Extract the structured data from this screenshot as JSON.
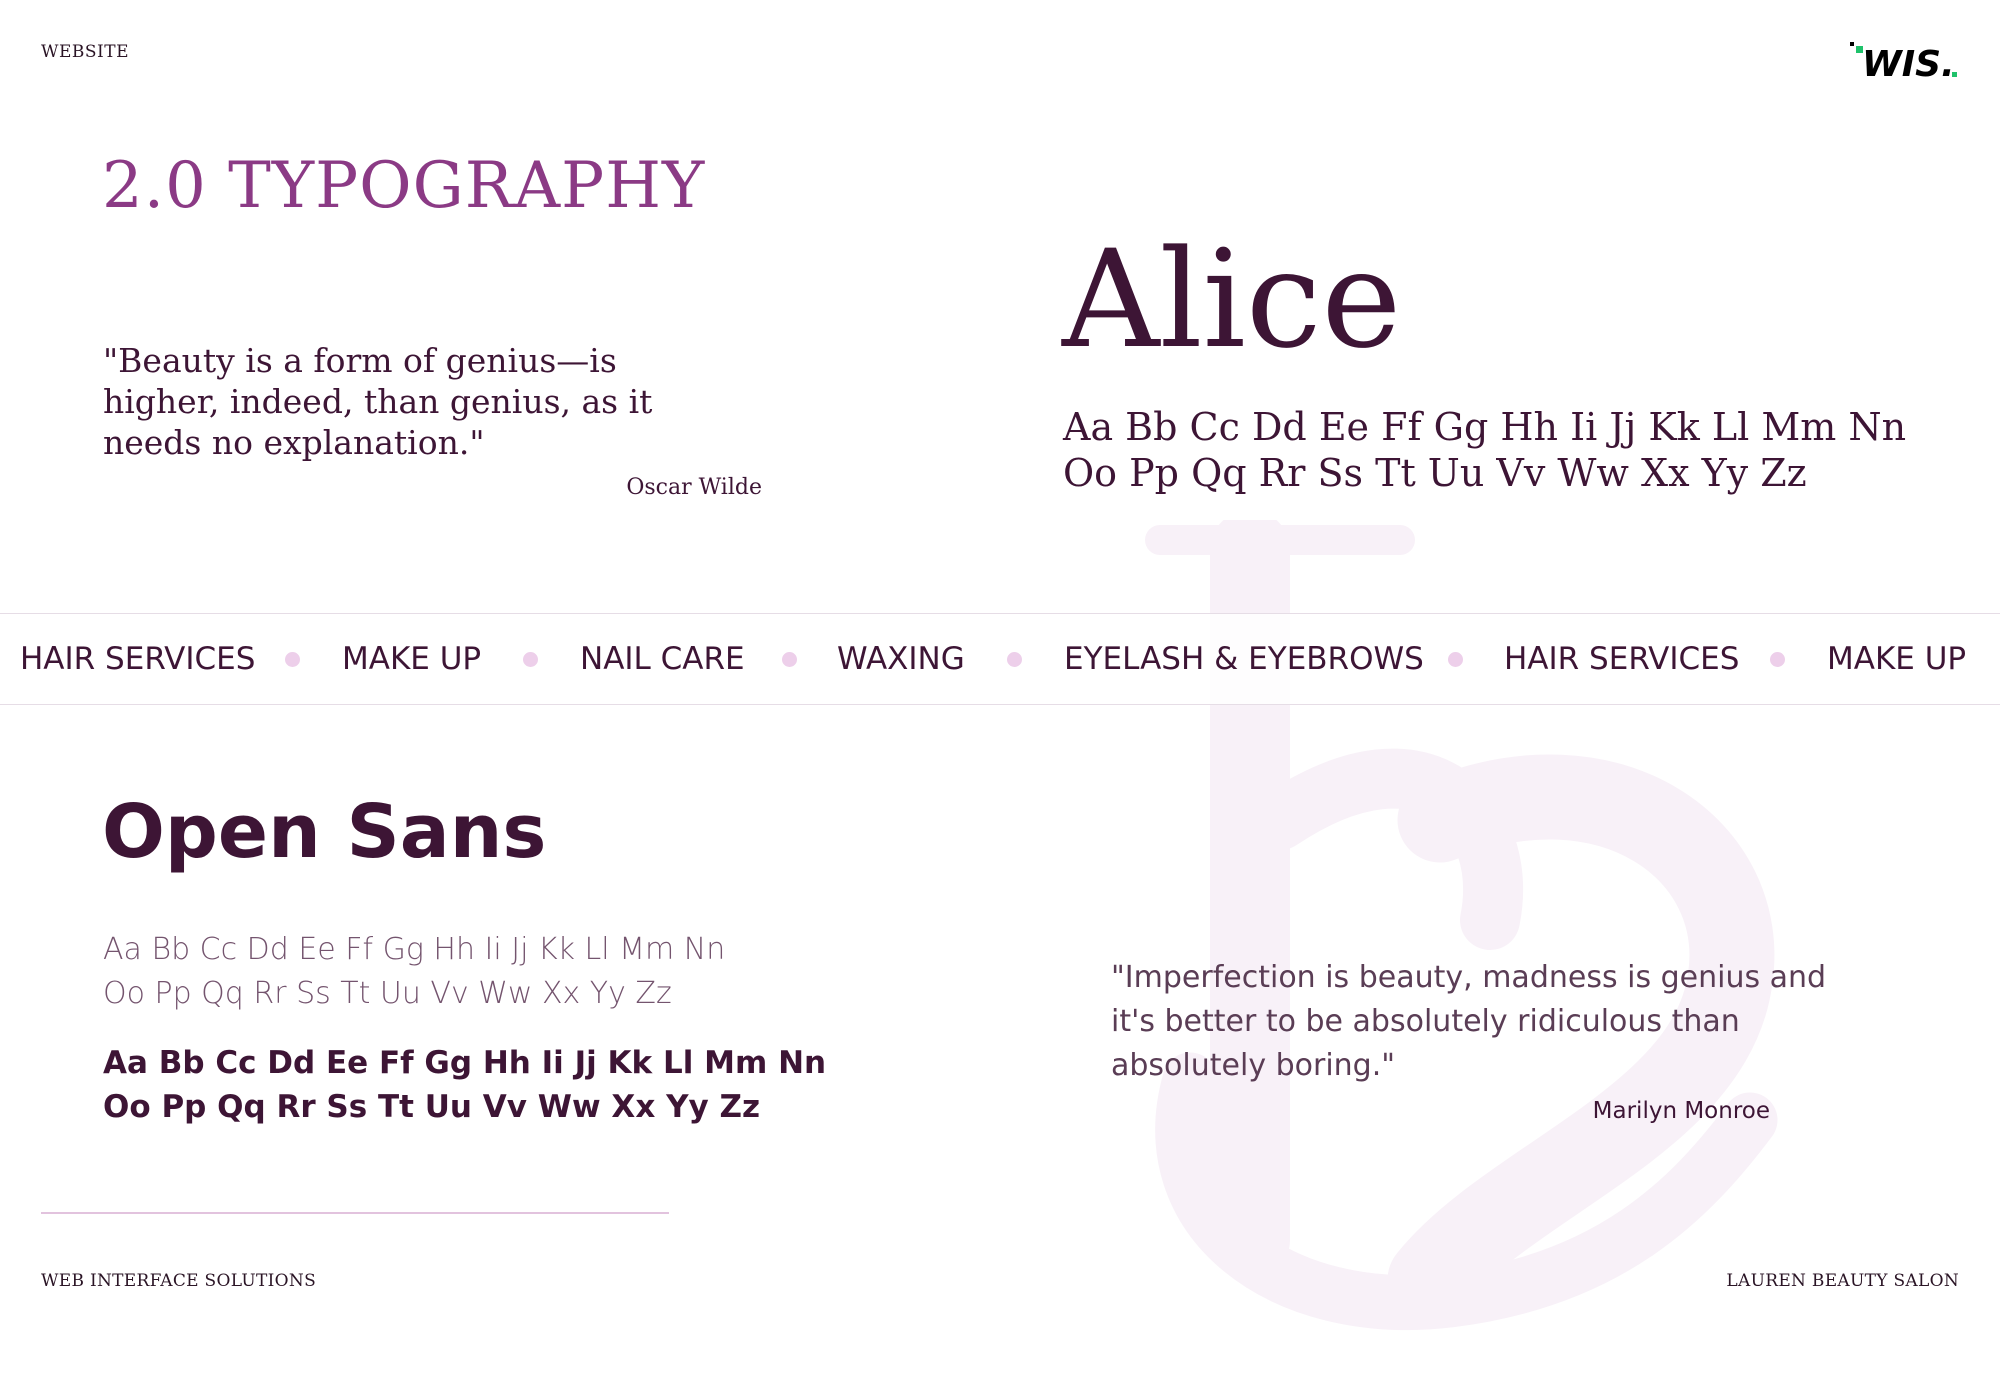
{
  "header": {
    "label": "WEBSITE",
    "logo_text": "WIS."
  },
  "section": {
    "title": "2.0 TYPOGRAPHY"
  },
  "serif_quote": {
    "text": "\"Beauty is a form of genius—is higher, indeed, than genius, as it needs no explanation.\"",
    "author": "Oscar Wilde"
  },
  "serif_font": {
    "name": "Alice",
    "specimen_line1": "Aa Bb Cc Dd Ee Ff Gg Hh Ii Jj Kk Ll Mm Nn",
    "specimen_line2": "Oo Pp Qq Rr Ss Tt Uu Vv Ww Xx Yy Zz"
  },
  "services": [
    "HAIR SERVICES",
    "MAKE UP",
    "NAIL CARE",
    "WAXING",
    "EYELASH & EYEBROWS",
    "HAIR SERVICES",
    "MAKE UP"
  ],
  "sans_font": {
    "name": "Open Sans",
    "light_line1": "Aa Bb Cc Dd Ee Ff Gg Hh Ii Jj Kk Ll Mm Nn",
    "light_line2": "Oo Pp Qq Rr Ss Tt Uu Vv Ww Xx Yy Zz",
    "bold_line1": "Aa Bb Cc Dd Ee Ff Gg Hh Ii Jj Kk Ll Mm Nn",
    "bold_line2": "Oo Pp Qq Rr Ss Tt Uu Vv Ww Xx Yy Zz"
  },
  "sans_quote": {
    "text": "\"Imperfection is beauty, madness is genius and it's better to be absolutely ridiculous than absolutely boring.\"",
    "author": "Marilyn Monroe"
  },
  "footer": {
    "left": "WEB INTERFACE SOLUTIONS",
    "right": "LAUREN BEAUTY SALON"
  },
  "colors": {
    "title_accent": "#8b3a85",
    "text_primary": "#3d1535",
    "text_light": "#74546e",
    "dot": "#edcfea",
    "logo_green": "#1fc26b"
  }
}
